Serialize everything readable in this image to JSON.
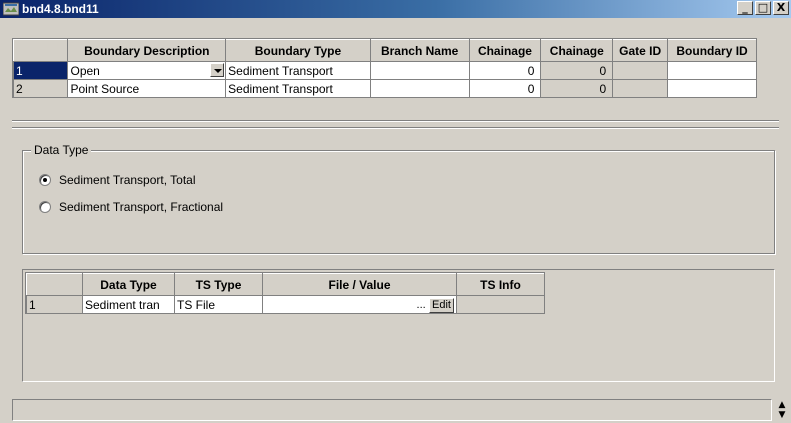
{
  "window": {
    "title": "bnd4.8.bnd11",
    "icon": "map-file-icon",
    "controls": {
      "minimize": "_",
      "maximize": "□",
      "close": "X"
    }
  },
  "boundary_grid": {
    "columns": [
      "",
      "Boundary Description",
      "Boundary Type",
      "Branch Name",
      "Chainage",
      "Chainage",
      "Gate ID",
      "Boundary ID"
    ],
    "rows": [
      {
        "index": "1",
        "description": "Open",
        "type": "Sediment Transport",
        "branch": "",
        "chainage1": "0",
        "chainage2": "0",
        "gate_id": "",
        "boundary_id": ""
      },
      {
        "index": "2",
        "description": "Point Source",
        "type": "Sediment Transport",
        "branch": "",
        "chainage1": "0",
        "chainage2": "0",
        "gate_id": "",
        "boundary_id": ""
      }
    ]
  },
  "data_type_group": {
    "legend": "Data Type",
    "options": [
      {
        "label": "Sediment Transport, Total",
        "checked": true
      },
      {
        "label": "Sediment Transport, Fractional",
        "checked": false
      }
    ]
  },
  "ts_grid": {
    "columns": [
      "",
      "Data Type",
      "TS Type",
      "File / Value",
      "TS Info"
    ],
    "rows": [
      {
        "index": "1",
        "data_type": "Sediment tran",
        "ts_type": "TS File",
        "file_value": "",
        "browse_label": "...",
        "edit_label": "Edit",
        "ts_info": ""
      }
    ]
  },
  "colors": {
    "titlebar_start": "#0a246a",
    "titlebar_end": "#a6caf0",
    "selection": "#0a246a",
    "face": "#d4d0c8"
  }
}
